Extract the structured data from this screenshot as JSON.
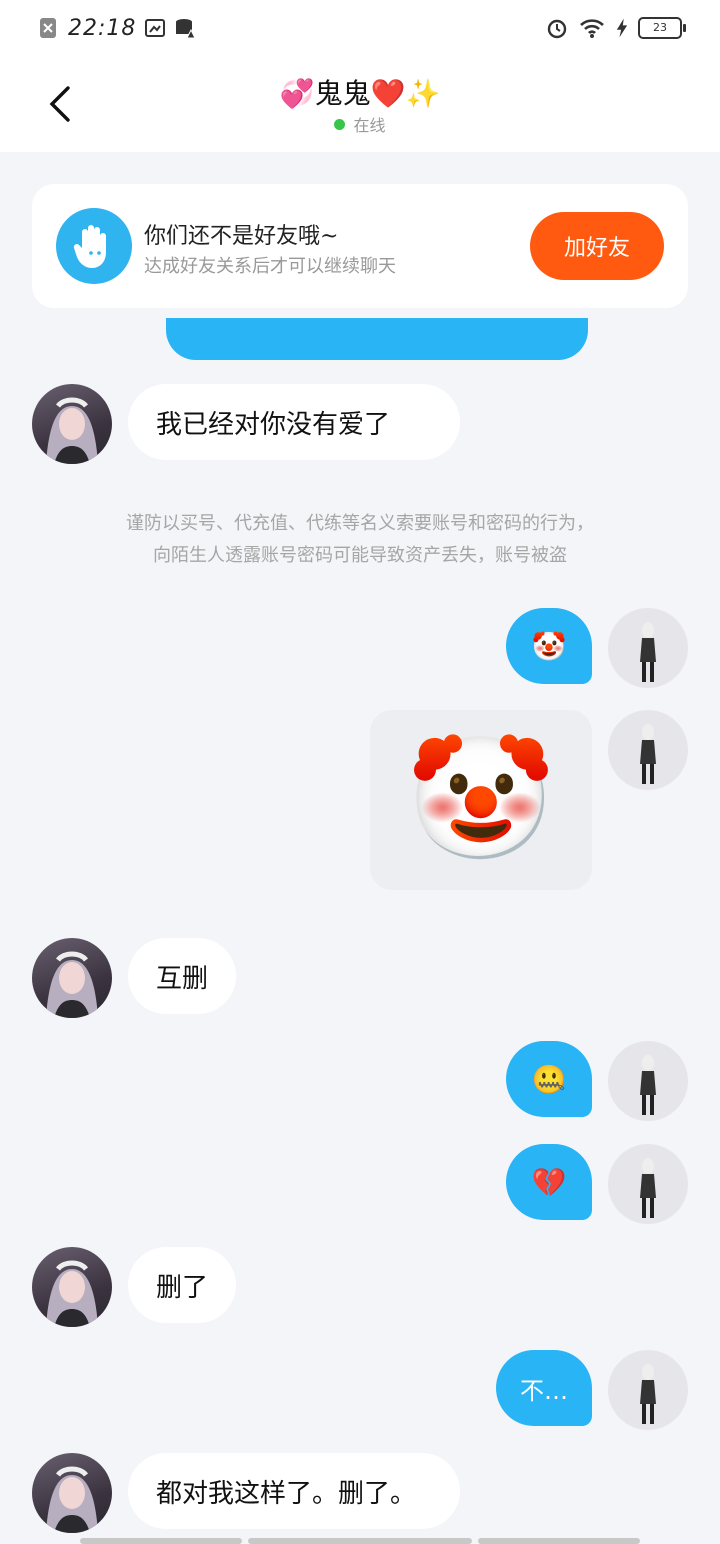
{
  "status_bar": {
    "time": "22:18",
    "battery": "23"
  },
  "header": {
    "title_name": "鬼鬼",
    "title_prefix_emoji": "💞",
    "title_suffix_emoji": "❤️✨",
    "online_status": "在线"
  },
  "friend_banner": {
    "title": "你们还不是好友哦~",
    "subtitle": "达成好友关系后才可以继续聊天",
    "add_button": "加好友"
  },
  "warning_text": [
    "谨防以买号、代充值、代练等名义索要账号和密码的行为，",
    "向陌生人透露账号密码可能导致资产丢失，账号被盗"
  ],
  "messages": [
    {
      "side": "left",
      "text": "我已经对你没有爱了"
    },
    {
      "side": "right",
      "text": "🤡"
    },
    {
      "side": "right",
      "text": "🤡",
      "kind": "sticker"
    },
    {
      "side": "left",
      "text": "互删"
    },
    {
      "side": "right",
      "text": "🤐"
    },
    {
      "side": "right",
      "text": "💔"
    },
    {
      "side": "left",
      "text": "删了"
    },
    {
      "side": "right",
      "text": "不…"
    },
    {
      "side": "left",
      "text": "都对我这样了。删了。"
    }
  ],
  "colors": {
    "accent_blue": "#29b4f6",
    "add_button": "#ff5a10",
    "background": "#f3f5f8",
    "online_dot": "#3ac44a"
  }
}
